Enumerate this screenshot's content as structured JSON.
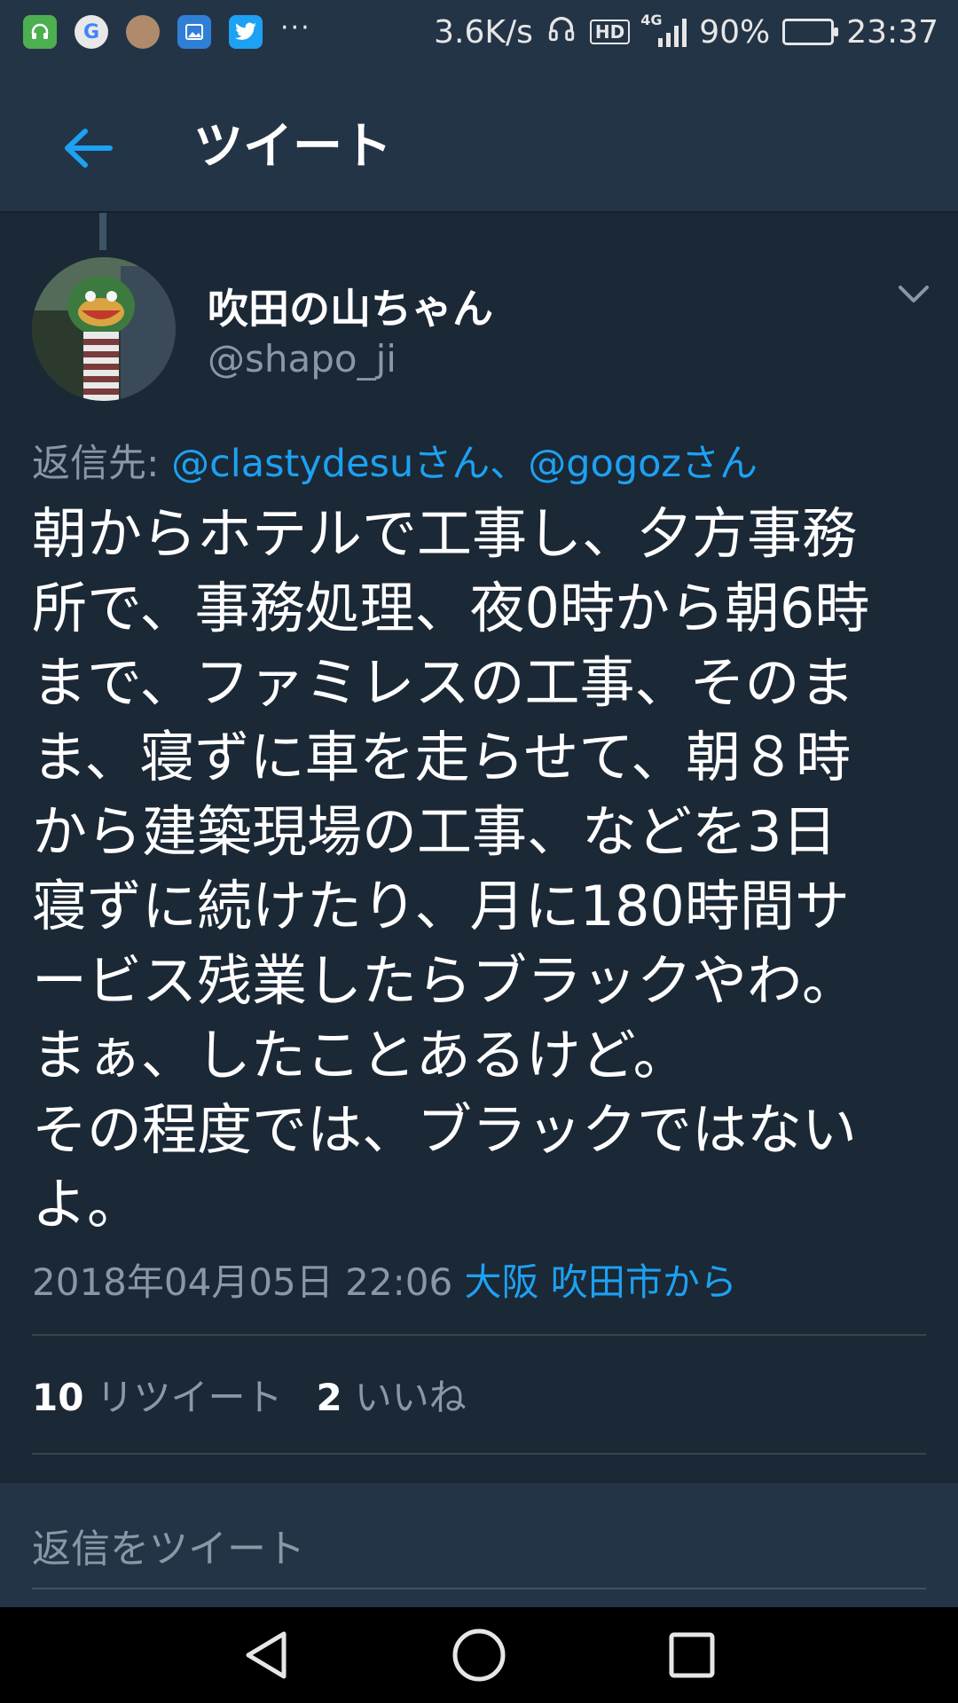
{
  "status_bar": {
    "speed": "3.6K/s",
    "hd": "HD",
    "network": "4G",
    "battery": "90%",
    "battery_level": 0.9,
    "time": "23:37",
    "more": "···",
    "google_letter": "G"
  },
  "header": {
    "title": "ツイート"
  },
  "tweet": {
    "display_name": "吹田の山ちゃん",
    "handle": "@shapo_ji",
    "reply_prefix": "返信先: ",
    "reply_mentions": "@clastydesuさん、@gogozさん",
    "body": "朝からホテルで工事し、夕方事務\n所で、事務処理、夜0時から朝6時\nまで、ファミレスの工事、そのま\nま、寝ずに車を走らせて、朝８時\nから建築現場の工事、などを3日\n寝ずに続けたり、月に180時間サ\nービス残業したらブラックやわ。\nまぁ、したことあるけど。\nその程度では、ブラックではない\nよ。",
    "timestamp": "2018年04月05日 22:06 ",
    "location": "大阪 吹田市から",
    "retweet_count": "10",
    "retweet_label": "リツイート",
    "like_count": "2",
    "like_label": "いいね"
  },
  "reply": {
    "placeholder": "返信をツイート"
  },
  "colors": {
    "background": "#1b2836",
    "bar": "#243447",
    "accent": "#1da1f2",
    "muted": "#8899a6"
  }
}
